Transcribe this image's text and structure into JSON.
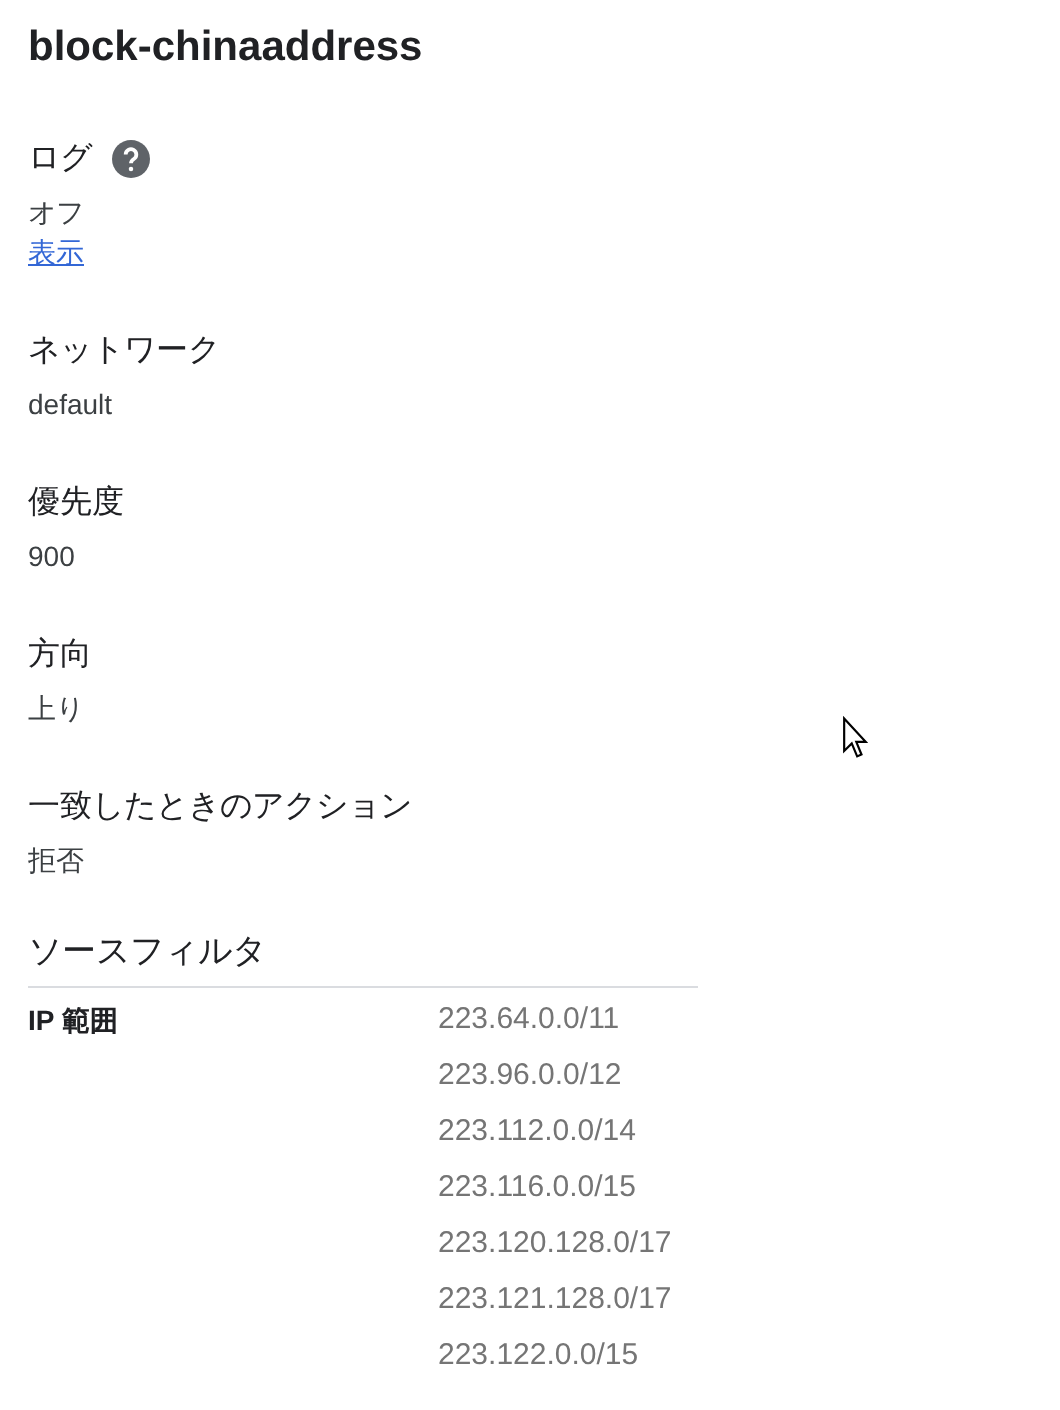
{
  "title": "block-chinaaddress",
  "fields": [
    {
      "label": "ログ",
      "help": true,
      "value": "オフ",
      "link": "表示"
    },
    {
      "label": "ネットワーク",
      "help": false,
      "value": "default"
    },
    {
      "label": "優先度",
      "help": false,
      "value": "900"
    },
    {
      "label": "方向",
      "help": false,
      "value": "上り"
    },
    {
      "label": "一致したときのアクション",
      "help": false,
      "value": "拒否"
    }
  ],
  "source_filter": {
    "heading": "ソースフィルタ",
    "rows": [
      {
        "label": "IP 範囲",
        "values": [
          "223.64.0.0/11",
          "223.96.0.0/12",
          "223.112.0.0/14",
          "223.116.0.0/15",
          "223.120.128.0/17",
          "223.121.128.0/17",
          "223.122.0.0/15"
        ]
      }
    ]
  }
}
